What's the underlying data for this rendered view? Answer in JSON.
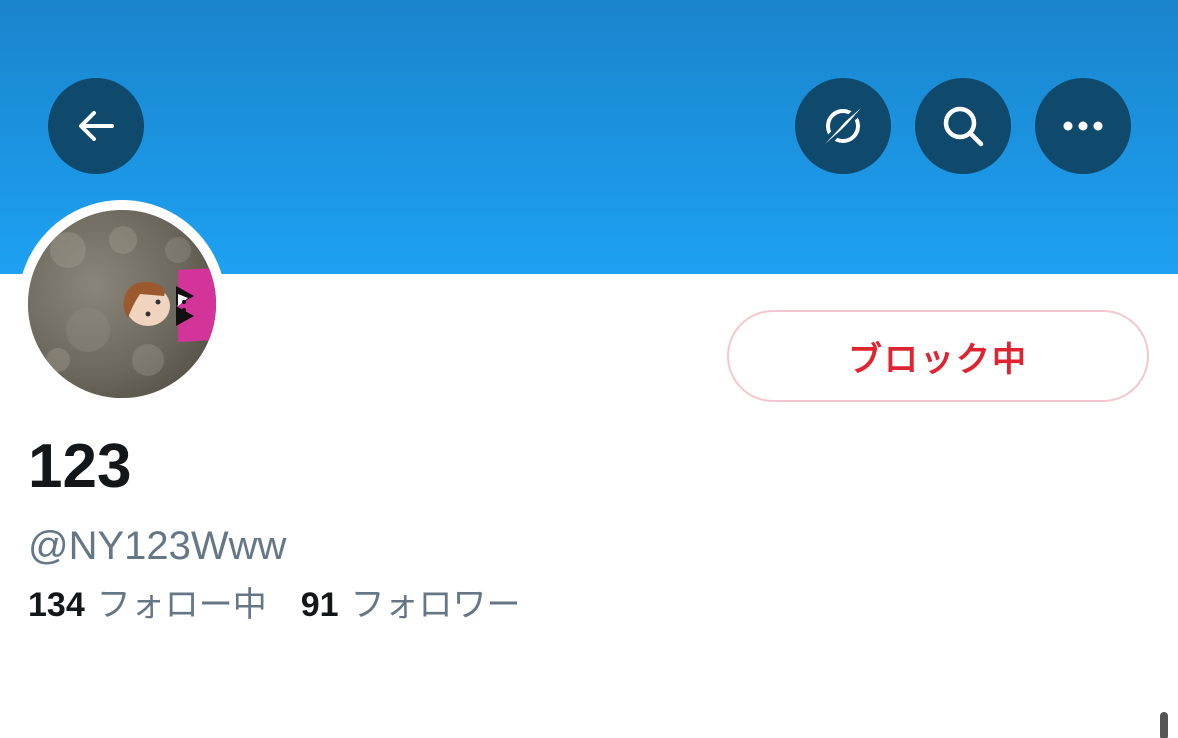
{
  "colors": {
    "banner_top": "#1a84cc",
    "banner_bottom": "#1da1f2",
    "round_button_bg": "#0f4a6d",
    "blocked_text": "#e0242f",
    "blocked_border": "#f5c6cd",
    "name_text": "#14171a",
    "muted_text": "#657786"
  },
  "header": {
    "icons": [
      "back-arrow-icon",
      "explore-icon",
      "search-icon",
      "more-icon"
    ]
  },
  "profile": {
    "display_name": "123",
    "handle": "@NY123Www",
    "blocked_label": "ブロック中",
    "stats": {
      "following_count": "134",
      "following_label": "フォロー中",
      "followers_count": "91",
      "followers_label": "フォロワー"
    }
  }
}
